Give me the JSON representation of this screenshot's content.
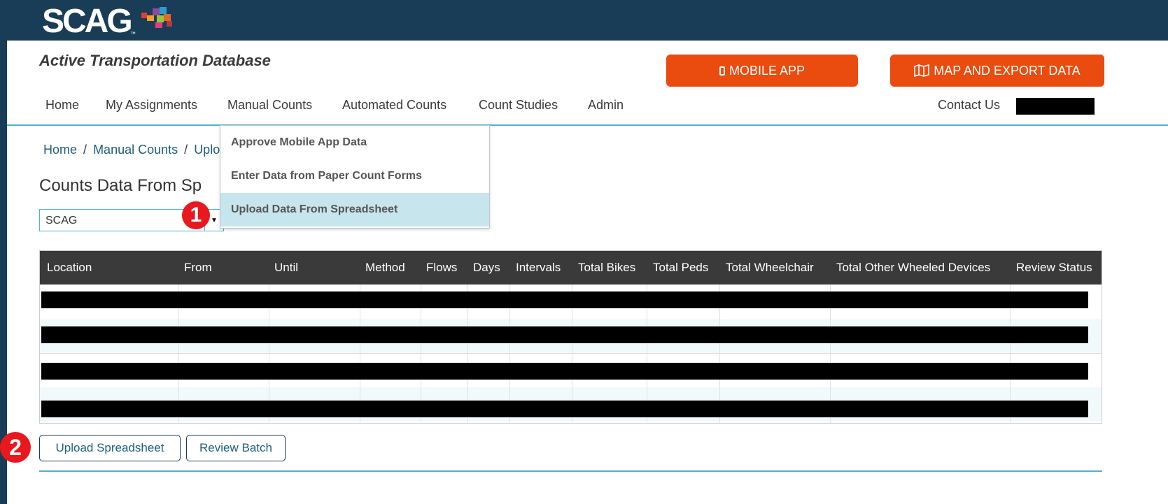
{
  "header": {
    "logo_text": "SCAG",
    "logo_tm": "™",
    "app_title": "Active Transportation Database",
    "mobile_app_label": "MOBILE APP",
    "map_export_label": "MAP AND EXPORT DATA"
  },
  "nav": {
    "items": [
      "Home",
      "My Assignments",
      "Manual Counts",
      "Automated Counts",
      "Count Studies",
      "Admin"
    ],
    "contact_label": "Contact Us"
  },
  "dropdown": {
    "items": [
      "Approve Mobile App Data",
      "Enter Data from Paper Count Forms",
      "Upload Data From Spreadsheet"
    ],
    "active_index": 2
  },
  "breadcrumb": {
    "home": "Home",
    "sep1": "/",
    "manual": "Manual Counts",
    "sep2": "/",
    "current": "Uplo"
  },
  "page": {
    "title": "Counts Data From Sp"
  },
  "org_select": {
    "value": "SCAG"
  },
  "table": {
    "columns": [
      "Location",
      "From",
      "Until",
      "Method",
      "Flows",
      "Days",
      "Intervals",
      "Total Bikes",
      "Total Peds",
      "Total Wheelchair",
      "Total Other Wheeled Devices",
      "Review Status"
    ]
  },
  "buttons": {
    "upload_spreadsheet": "Upload Spreadsheet",
    "review_batch": "Review Batch"
  },
  "callouts": {
    "one": "1",
    "two": "2"
  },
  "colors": {
    "navy": "#1a3d57",
    "orange": "#ea4b0e",
    "accent": "#4bb3cf",
    "callout_red": "#e8191e",
    "header_dark": "#3a3a3a",
    "dropdown_active": "#c7e5ec"
  }
}
